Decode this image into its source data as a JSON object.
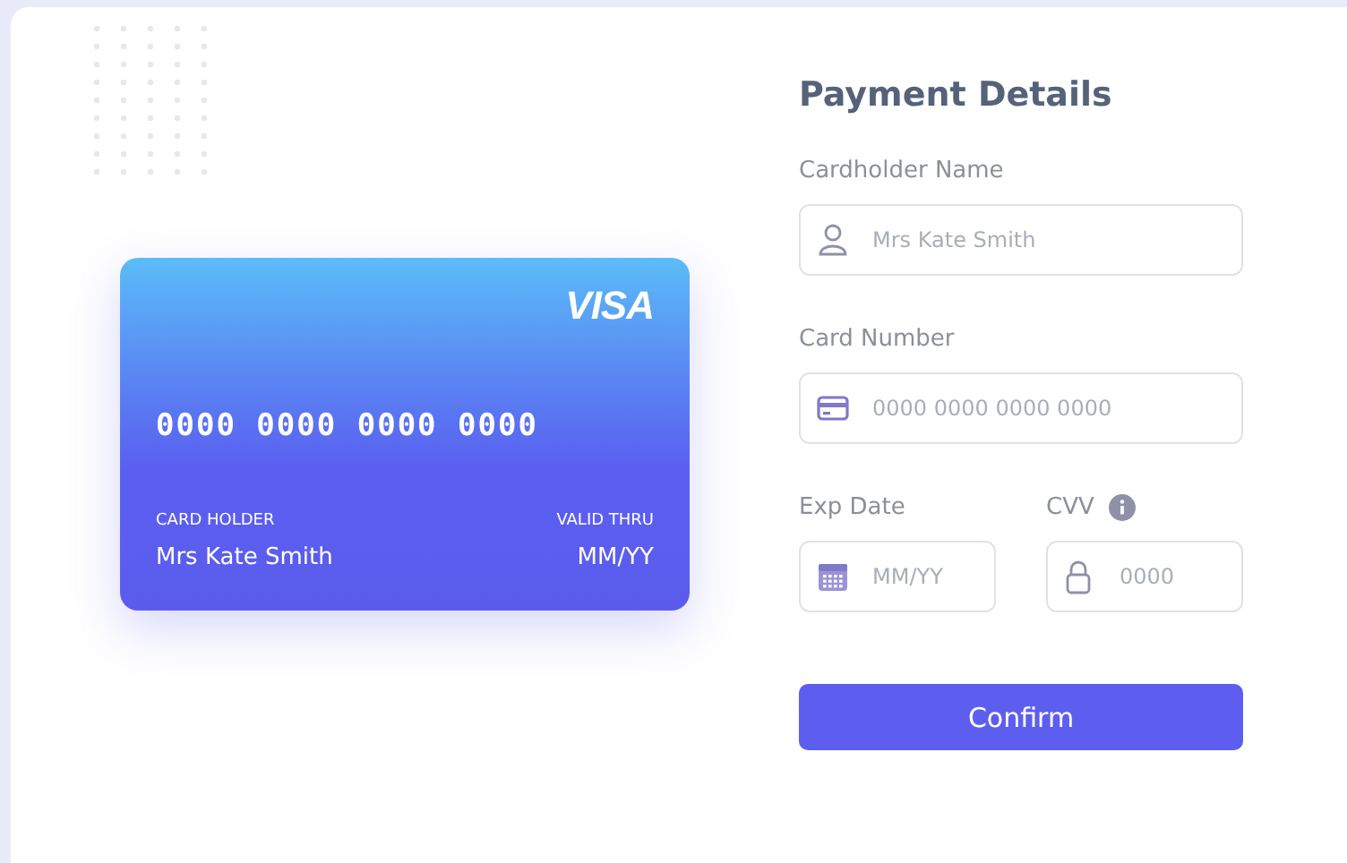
{
  "card": {
    "brand": "VISA",
    "number": "0000 0000 0000 0000",
    "holder_label": "CARD HOLDER",
    "holder": "Mrs Kate Smith",
    "valid_label": "VALID THRU",
    "valid": "MM/YY"
  },
  "form": {
    "title": "Payment Details",
    "fields": [
      {
        "kind": "name",
        "label": "Cardholder Name",
        "placeholder": "Mrs Kate Smith",
        "info": false
      },
      {
        "kind": "number",
        "label": "Card Number",
        "placeholder": "0000 0000 0000 0000",
        "info": false
      },
      {
        "kind": "expiry",
        "label": "Exp Date",
        "placeholder": "MM/YY",
        "info": false
      },
      {
        "kind": "cvv",
        "label": "CVV",
        "placeholder": "0000",
        "info": true
      }
    ],
    "button": "Confirm"
  }
}
